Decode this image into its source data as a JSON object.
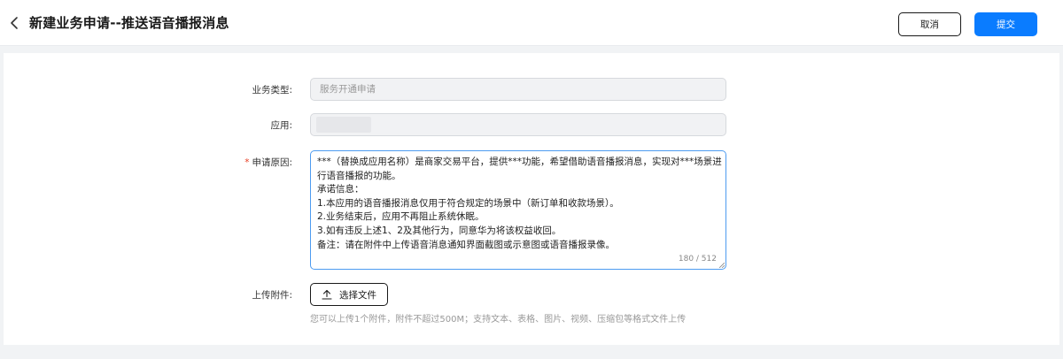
{
  "header": {
    "title": "新建业务申请--推送语音播报消息",
    "cancel_label": "取消",
    "submit_label": "提交"
  },
  "form": {
    "business_type": {
      "label": "业务类型:",
      "value": "服务开通申请"
    },
    "app": {
      "label": "应用:",
      "value": ""
    },
    "reason": {
      "required_mark": "*",
      "label": "申请原因:",
      "lines": [
        "***（替换成应用名称）是商家交易平台，提供***功能，希望借助语音播报消息，实现对***场景进",
        "行语音播报的功能。",
        "承诺信息：",
        "1.本应用的语音播报消息仅用于符合规定的场景中（新订单和收款场景）。",
        "2.业务结束后，应用不再阻止系统休眠。",
        "3.如有违反上述1、2及其他行为，同意华为将该权益收回。",
        "备注：请在附件中上传语音消息通知界面截图或示意图或语音播报录像。"
      ],
      "counter": "180 / 512"
    },
    "attachment": {
      "label": "上传附件:",
      "button_label": "选择文件",
      "hint": "您可以上传1个附件，附件不超过500M；支持文本、表格、图片、视频、压缩包等格式文件上传"
    }
  },
  "colors": {
    "primary": "#0a7cff",
    "required": "#e84026",
    "focus_border": "#4d9bf0"
  },
  "icons": {
    "back": "chevron-left-icon",
    "upload": "upload-icon"
  }
}
